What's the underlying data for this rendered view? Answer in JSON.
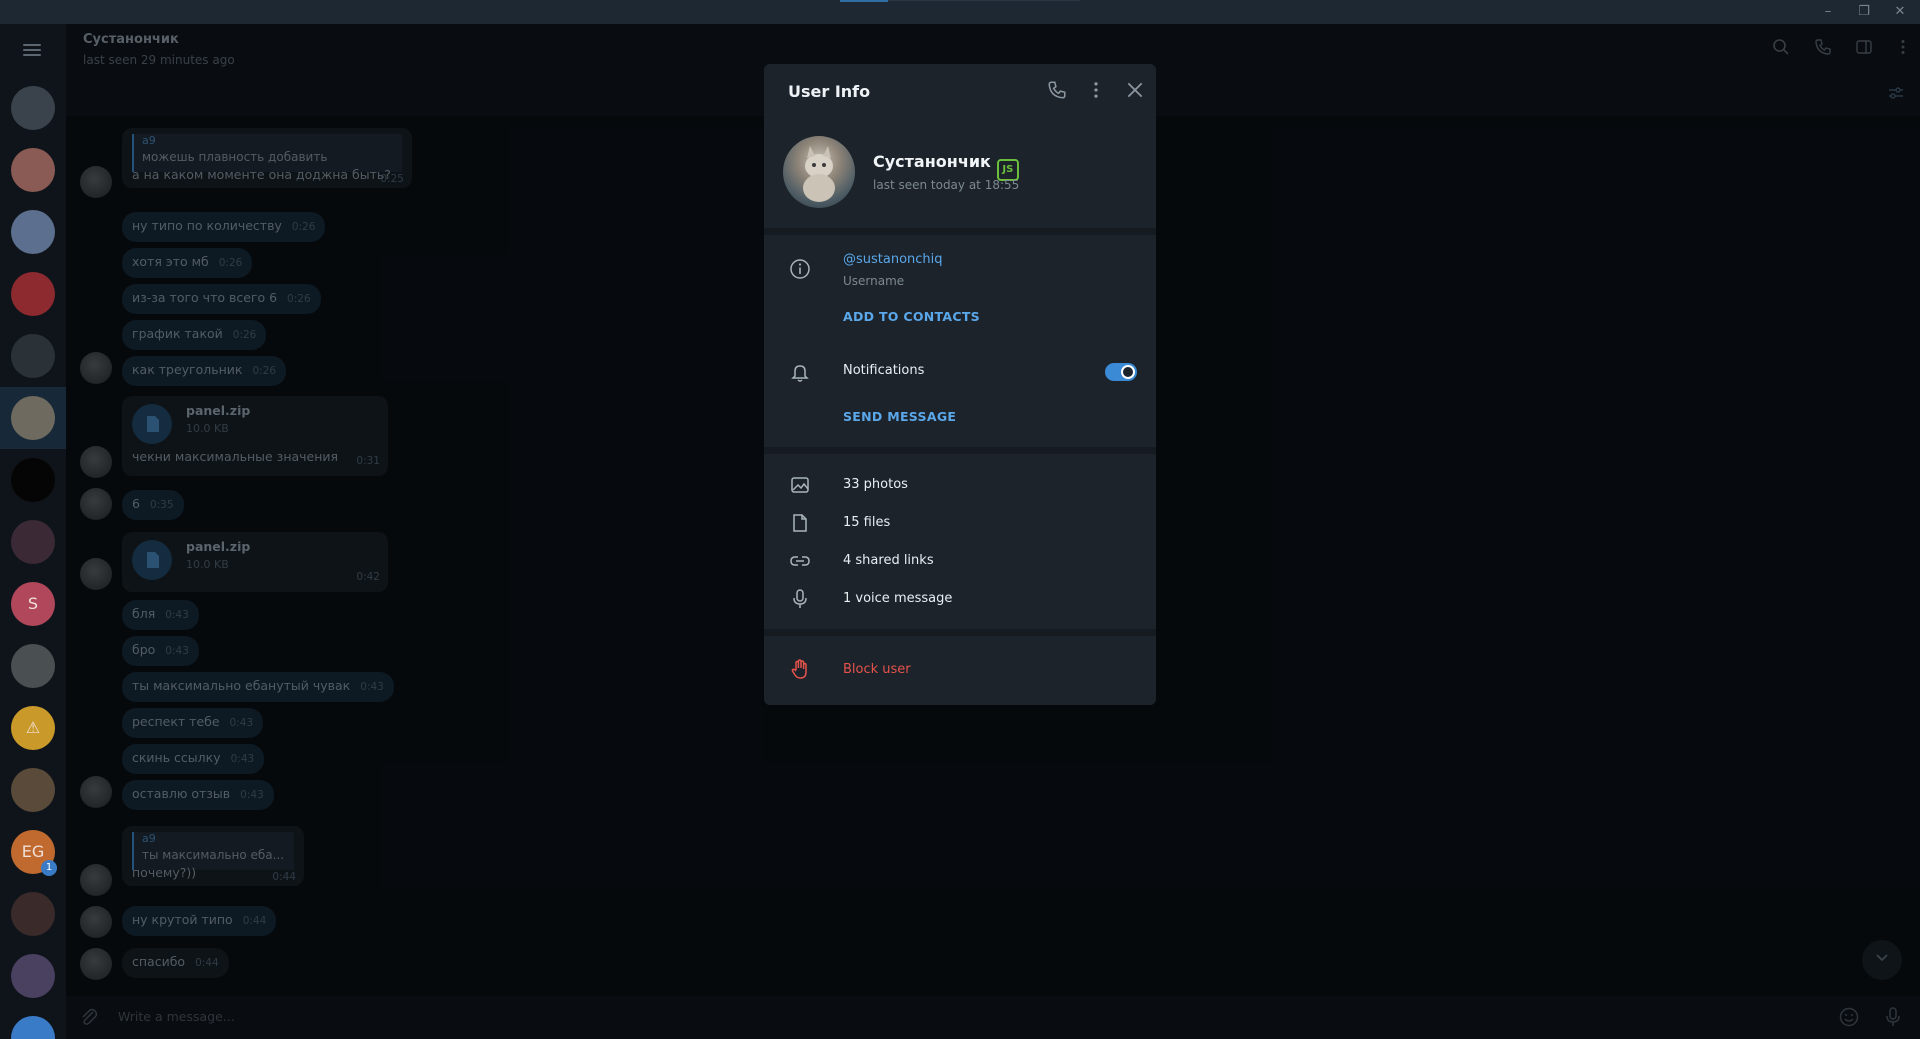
{
  "window": {
    "minimize": "–",
    "maximize": "❐",
    "close": "✕"
  },
  "chat": {
    "name": "Сустанончик",
    "status": "last seen 29 minutes ago",
    "composer_placeholder": "Write a message..."
  },
  "messages": [
    {
      "reply_author": "a9",
      "reply_text": "можешь плавность добавить",
      "text": "а на каком моменте она доджна быть?",
      "time": "0:25",
      "dir": "in"
    },
    {
      "text": "ну типо по количеству",
      "time": "0:26",
      "dir": "out"
    },
    {
      "text": "хотя это мб",
      "time": "0:26",
      "dir": "out"
    },
    {
      "text": "из-за того что всего 6",
      "time": "0:26",
      "dir": "out"
    },
    {
      "text": "график такой",
      "time": "0:26",
      "dir": "out"
    },
    {
      "text": "как треугольник",
      "time": "0:26",
      "dir": "out"
    },
    {
      "file_name": "panel.zip",
      "file_size": "10.0 KB",
      "text": "чекни максимальные значения",
      "time": "0:31",
      "dir": "in"
    },
    {
      "text": "6",
      "time": "0:35",
      "dir": "out"
    },
    {
      "file_name": "panel.zip",
      "file_size": "10.0 KB",
      "time": "0:42",
      "dir": "in"
    },
    {
      "text": "бля",
      "time": "0:43",
      "dir": "out"
    },
    {
      "text": "бро",
      "time": "0:43",
      "dir": "out"
    },
    {
      "text": "ты максимально ебанутый чувак",
      "time": "0:43",
      "dir": "out"
    },
    {
      "text": "респект тебе",
      "time": "0:43",
      "dir": "out"
    },
    {
      "text": "скинь ссылку",
      "time": "0:43",
      "dir": "out"
    },
    {
      "text": "оставлю отзыв",
      "time": "0:43",
      "dir": "out"
    },
    {
      "reply_author": "a9",
      "reply_text": "ты максимально еба...",
      "text": "почему?))",
      "time": "0:44",
      "dir": "in"
    },
    {
      "text": "ну крутой типо",
      "time": "0:44",
      "dir": "out"
    },
    {
      "text": "спасибо",
      "time": "0:44",
      "dir": "in"
    }
  ],
  "sidebar": {
    "avatars": [
      {
        "color": "#3a434b"
      },
      {
        "color": "#8a5a55"
      },
      {
        "color": "#5c6f8e"
      },
      {
        "color": "#8c2a30"
      },
      {
        "color": "#2a3238"
      },
      {
        "color": "#6f6a60"
      },
      {
        "color": "#050505"
      },
      {
        "color": "#3b2a36"
      },
      {
        "color": "#b0475a",
        "letter": "S"
      },
      {
        "color": "#4a4f52"
      },
      {
        "color": "#c99a2a",
        "letter": "⚠"
      },
      {
        "color": "#5a4a3a"
      },
      {
        "color": "#c06a30",
        "letter": "EG",
        "badge": "1"
      },
      {
        "color": "#3a2a2a"
      },
      {
        "color": "#4a4060"
      },
      {
        "color": "#3a7bc8"
      }
    ]
  },
  "user_info": {
    "title": "User Info",
    "name": "Сустанончик",
    "badge": "JS",
    "status": "last seen today at 18:55",
    "username": "@sustanonchiq",
    "username_label": "Username",
    "add_to_contacts": "ADD TO CONTACTS",
    "notifications_label": "Notifications",
    "notifications_on": true,
    "send_message": "SEND MESSAGE",
    "media": [
      {
        "label": "33 photos",
        "icon": "photo-icon"
      },
      {
        "label": "15 files",
        "icon": "file-icon"
      },
      {
        "label": "4 shared links",
        "icon": "link-icon"
      },
      {
        "label": "1 voice message",
        "icon": "microphone-icon"
      }
    ],
    "block_user": "Block user"
  },
  "colors": {
    "accent": "#5aa7ea",
    "danger": "#e5534b",
    "badge_green": "#6bbf3a"
  }
}
